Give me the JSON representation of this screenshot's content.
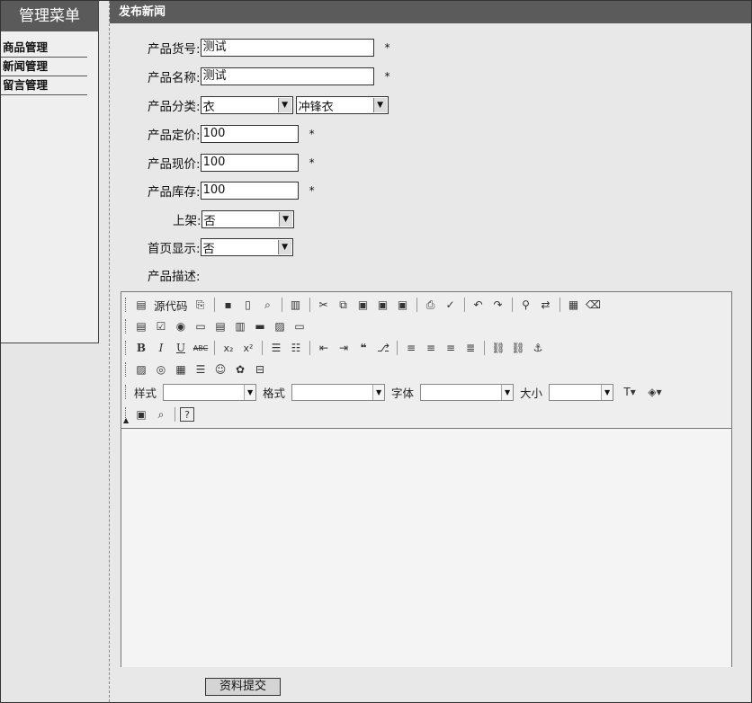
{
  "sidebar": {
    "title": "管理菜单",
    "items": [
      {
        "label": "商品管理"
      },
      {
        "label": "新闻管理"
      },
      {
        "label": "留言管理"
      }
    ]
  },
  "header": {
    "title": "发布新闻"
  },
  "form": {
    "sku": {
      "label": "产品货号:",
      "value": "测试",
      "required": "*"
    },
    "name": {
      "label": "产品名称:",
      "value": "测试",
      "required": "*"
    },
    "category": {
      "label": "产品分类:",
      "value1": "衣",
      "value2": "冲锋衣"
    },
    "list_price": {
      "label": "产品定价:",
      "value": "100",
      "required": "*"
    },
    "current_price": {
      "label": "产品现价:",
      "value": "100",
      "required": "*"
    },
    "stock": {
      "label": "产品库存:",
      "value": "100",
      "required": "*"
    },
    "on_shelf": {
      "label": "上架:",
      "value": "否"
    },
    "homepage": {
      "label": "首页显示:",
      "value": "否"
    },
    "description": {
      "label": "产品描述:"
    }
  },
  "editor": {
    "source_label": "源代码",
    "style_label": "样式",
    "format_label": "格式",
    "font_label": "字体",
    "size_label": "大小"
  },
  "submit_label": "资料提交"
}
